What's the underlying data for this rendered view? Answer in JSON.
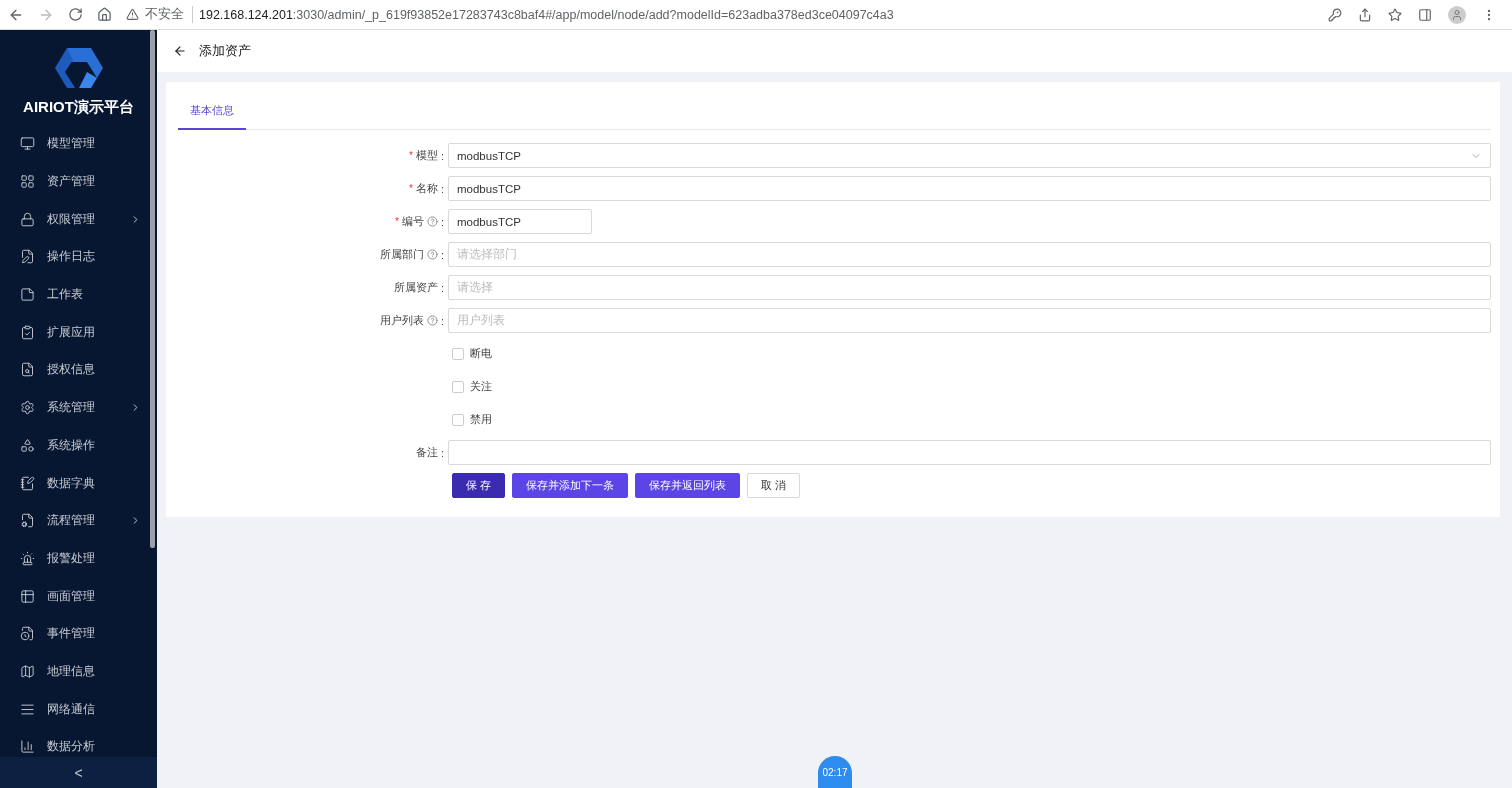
{
  "browser": {
    "security_label": "不安全",
    "url_host": "192.168.124.201",
    "url_path": ":3030/admin/_p_619f93852e17283743c8baf4#/app/model/node/add?modelId=623adba378ed3ce04097c4a3"
  },
  "sidebar": {
    "brand": "AIRIOT演示平台",
    "items": [
      {
        "label": "模型管理",
        "expandable": false
      },
      {
        "label": "资产管理",
        "expandable": false
      },
      {
        "label": "权限管理",
        "expandable": true
      },
      {
        "label": "操作日志",
        "expandable": false
      },
      {
        "label": "工作表",
        "expandable": false
      },
      {
        "label": "扩展应用",
        "expandable": false
      },
      {
        "label": "授权信息",
        "expandable": false
      },
      {
        "label": "系统管理",
        "expandable": true
      },
      {
        "label": "系统操作",
        "expandable": false
      },
      {
        "label": "数据字典",
        "expandable": false
      },
      {
        "label": "流程管理",
        "expandable": true
      },
      {
        "label": "报警处理",
        "expandable": false
      },
      {
        "label": "画面管理",
        "expandable": false
      },
      {
        "label": "事件管理",
        "expandable": false
      },
      {
        "label": "地理信息",
        "expandable": false
      },
      {
        "label": "网络通信",
        "expandable": false
      },
      {
        "label": "数据分析",
        "expandable": false
      }
    ],
    "collapse": "<"
  },
  "page": {
    "title": "添加资产"
  },
  "tabs": [
    {
      "label": "基本信息",
      "selected": true
    }
  ],
  "form": [
    {
      "kind": "select",
      "required_mark": "*",
      "label": "模型",
      "help": false,
      "colon": ":",
      "value": "modbusTCP"
    },
    {
      "kind": "text",
      "required_mark": "*",
      "label": "名称",
      "help": false,
      "colon": ":",
      "value": "modbusTCP"
    },
    {
      "kind": "short",
      "required_mark": "*",
      "label": "编号",
      "help": true,
      "colon": ":",
      "value": "modbusTCP"
    },
    {
      "kind": "text",
      "label": "所属部门",
      "help": true,
      "colon": ":",
      "placeholder": "请选择部门"
    },
    {
      "kind": "text",
      "label": "所属资产",
      "help": false,
      "colon": ":",
      "placeholder": "请选择"
    },
    {
      "kind": "text",
      "label": "用户列表",
      "help": true,
      "colon": ":",
      "placeholder": "用户列表"
    },
    {
      "kind": "checkbox",
      "label": "断电",
      "checked": false
    },
    {
      "kind": "checkbox",
      "label": "关注",
      "checked": false
    },
    {
      "kind": "checkbox",
      "label": "禁用",
      "checked": false
    },
    {
      "kind": "text",
      "label": "备注",
      "help": false,
      "colon": ":"
    }
  ],
  "buttons": [
    {
      "label": "保 存",
      "kind": "primary",
      "pressed": true
    },
    {
      "label": "保存并添加下一条",
      "kind": "primary",
      "pressed": false
    },
    {
      "label": "保存并返回列表",
      "kind": "primary",
      "pressed": false
    },
    {
      "label": "取 消",
      "kind": "default",
      "pressed": false
    }
  ],
  "timer_badge": "02:17"
}
